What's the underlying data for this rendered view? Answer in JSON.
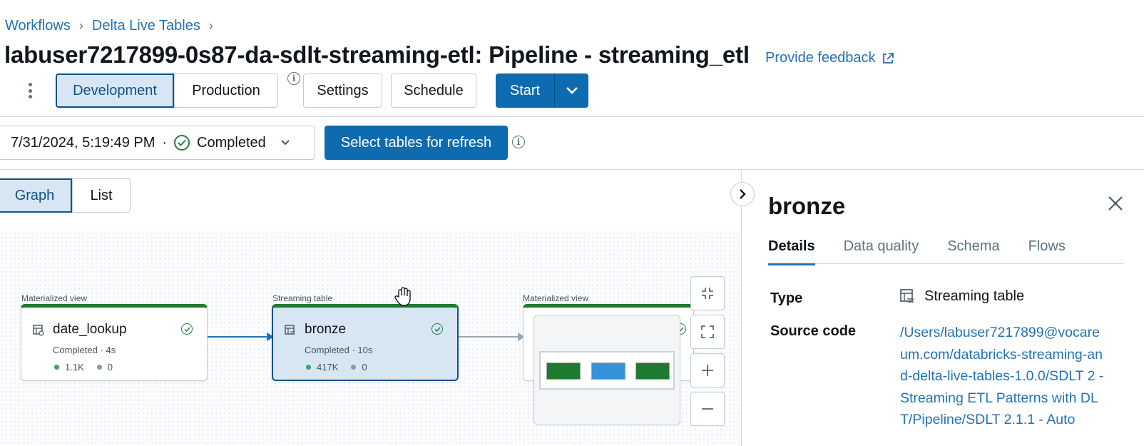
{
  "breadcrumb": {
    "items": [
      "Workflows",
      "Delta Live Tables"
    ]
  },
  "page": {
    "title": "labuser7217899-0s87-da-sdlt-streaming-etl: Pipeline - streaming_etl",
    "feedback_label": "Provide feedback"
  },
  "toolbar": {
    "mode_options": [
      "Development",
      "Production"
    ],
    "active_mode": "Development",
    "settings_label": "Settings",
    "schedule_label": "Schedule",
    "start_label": "Start"
  },
  "run": {
    "timestamp": "7/31/2024, 5:19:49 PM",
    "separator": "·",
    "status": "Completed",
    "refresh_label": "Select tables for refresh"
  },
  "view_toggle": {
    "options": [
      "Graph",
      "List"
    ],
    "active": "Graph"
  },
  "graph": {
    "nodes": [
      {
        "type_label": "Materialized view",
        "name": "date_lookup",
        "status": "Completed · 4s",
        "metric_green": "1.1K",
        "metric_grey": "0"
      },
      {
        "type_label": "Streaming table",
        "name": "bronze",
        "status": "Completed · 10s",
        "metric_green": "417K",
        "metric_grey": "0"
      },
      {
        "type_label": "Materialized view",
        "name": "",
        "status": "",
        "metric_green": "",
        "metric_grey": ""
      }
    ],
    "zoom_controls": [
      "fit-collapse",
      "fullscreen",
      "zoom-in",
      "zoom-out"
    ]
  },
  "details_panel": {
    "title": "bronze",
    "tabs": [
      "Details",
      "Data quality",
      "Schema",
      "Flows"
    ],
    "active_tab": "Details",
    "type_label": "Type",
    "type_value": "Streaming table",
    "source_label": "Source code",
    "source_value": "/Users/labuser7217899@vocareum.com/databricks-streaming-and-delta-live-tables-1.0.0/SDLT 2 - Streaming ETL Patterns with DLT/Pipeline/SDLT 2.1.1 - Auto"
  },
  "colors": {
    "accent": "#2272b4",
    "primary_button": "#0e6bb0",
    "success": "#277c43",
    "node_top": "#1e7a2e"
  }
}
